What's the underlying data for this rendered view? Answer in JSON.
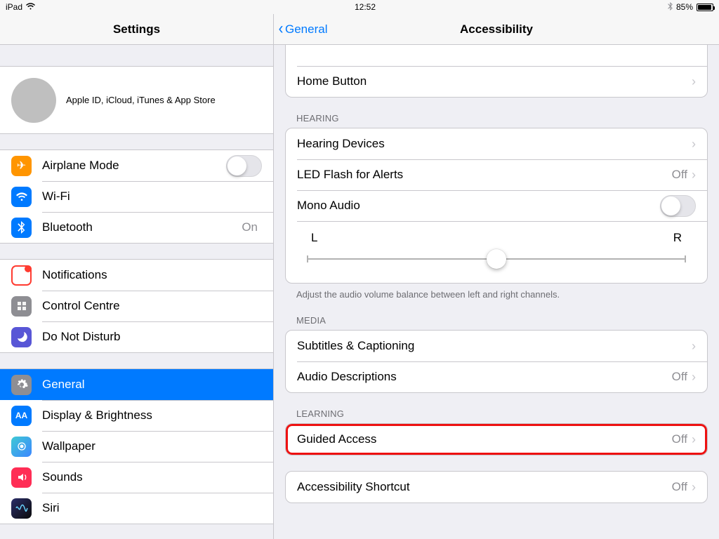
{
  "status": {
    "device": "iPad",
    "time": "12:52",
    "battery_percent": "85%"
  },
  "sidebar": {
    "title": "Settings",
    "apple_id_label": "Apple ID, iCloud, iTunes & App Store",
    "items": [
      {
        "label": "Airplane Mode",
        "icon": "airplane-icon",
        "bg": "bg-orange",
        "switch": false
      },
      {
        "label": "Wi-Fi",
        "icon": "wifi-icon",
        "bg": "bg-blue",
        "value": ""
      },
      {
        "label": "Bluetooth",
        "icon": "bluetooth-icon",
        "bg": "bg-blue",
        "value": "On"
      }
    ],
    "items2": [
      {
        "label": "Notifications",
        "icon": "notifications-icon",
        "bg": "bg-red"
      },
      {
        "label": "Control Centre",
        "icon": "control-centre-icon",
        "bg": "bg-gray"
      },
      {
        "label": "Do Not Disturb",
        "icon": "dnd-icon",
        "bg": "bg-purple"
      }
    ],
    "items3": [
      {
        "label": "General",
        "icon": "gear-icon",
        "bg": "bg-gray",
        "selected": true
      },
      {
        "label": "Display & Brightness",
        "icon": "display-icon",
        "bg": "bg-blue"
      },
      {
        "label": "Wallpaper",
        "icon": "wallpaper-icon",
        "bg": "wallpaper-icon"
      },
      {
        "label": "Sounds",
        "icon": "sounds-icon",
        "bg": "bg-pink"
      },
      {
        "label": "Siri",
        "icon": "siri-icon",
        "bg": "siri-icon"
      }
    ]
  },
  "detail": {
    "back_label": "General",
    "title": "Accessibility",
    "rows_top": [
      {
        "label": "Home Button"
      }
    ],
    "hearing_header": "HEARING",
    "hearing_rows": {
      "devices": {
        "label": "Hearing Devices"
      },
      "led": {
        "label": "LED Flash for Alerts",
        "value": "Off"
      },
      "mono": {
        "label": "Mono Audio",
        "switch": false
      },
      "balance_L": "L",
      "balance_R": "R"
    },
    "hearing_footer": "Adjust the audio volume balance between left and right channels.",
    "media_header": "MEDIA",
    "media_rows": [
      {
        "label": "Subtitles & Captioning"
      },
      {
        "label": "Audio Descriptions",
        "value": "Off"
      }
    ],
    "learning_header": "LEARNING",
    "learning_rows": [
      {
        "label": "Guided Access",
        "value": "Off",
        "highlight": true
      }
    ],
    "shortcut_rows": [
      {
        "label": "Accessibility Shortcut",
        "value": "Off"
      }
    ]
  }
}
